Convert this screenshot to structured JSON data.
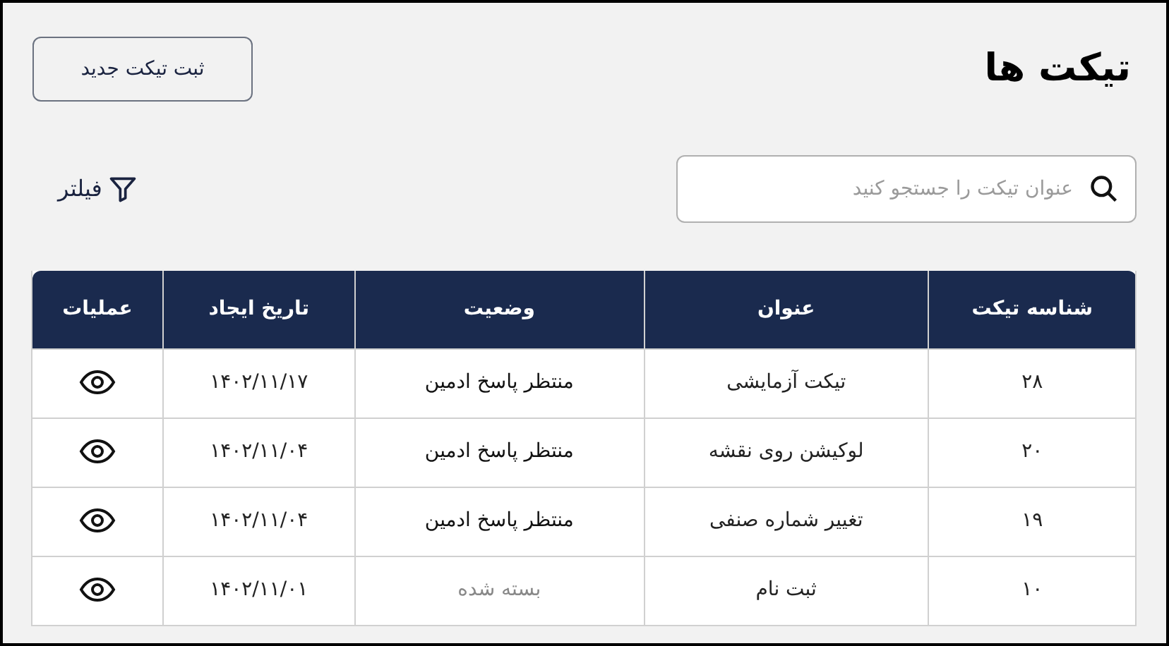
{
  "title": "تیکت ها",
  "new_ticket_button": "ثبت تیکت جدید",
  "search": {
    "placeholder": "عنوان تیکت را جستجو کنید"
  },
  "filter_button": "فیلتر",
  "table": {
    "columns": [
      "شناسه تیکت",
      "عنوان",
      "وضعیت",
      "تاریخ ایجاد",
      "عملیات"
    ],
    "rows": [
      {
        "id": "۲۸",
        "subject": "تیکت آزمایشی",
        "status": "منتظر پاسخ ادمین",
        "kind": "open",
        "date": "۱۴۰۲/۱۱/۱۷"
      },
      {
        "id": "۲۰",
        "subject": "لوکیشن روی نقشه",
        "status": "منتظر پاسخ ادمین",
        "kind": "open",
        "date": "۱۴۰۲/۱۱/۰۴"
      },
      {
        "id": "۱۹",
        "subject": "تغییر شماره صنفی",
        "status": "منتظر پاسخ ادمین",
        "kind": "open",
        "date": "۱۴۰۲/۱۱/۰۴"
      },
      {
        "id": "۱۰",
        "subject": "ثبت نام",
        "status": "بسته شده",
        "kind": "closed",
        "date": "۱۴۰۲/۱۱/۰۱"
      }
    ]
  }
}
